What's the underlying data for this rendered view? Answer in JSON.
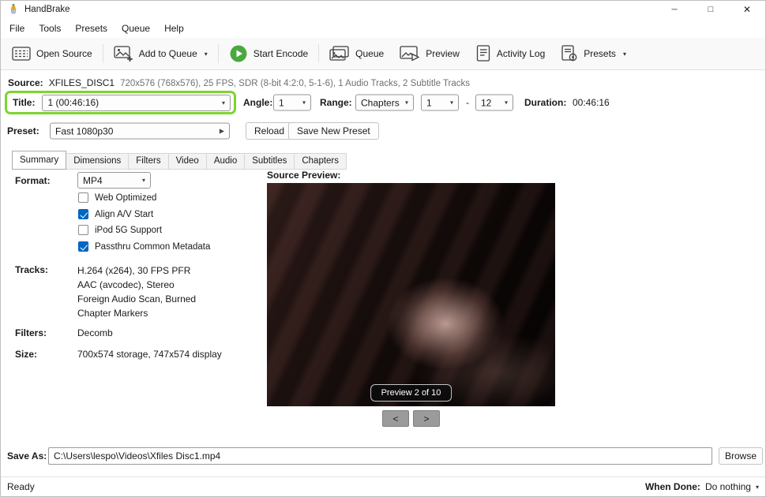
{
  "colors": {
    "highlight_green": "#7cd52e",
    "encode_green": "#4ba83f",
    "checkbox_blue": "#0067c0"
  },
  "icons": {
    "minimize": "─",
    "maximize": "□",
    "close": "✕",
    "chevron_down": "▾",
    "chevron_right": "▶",
    "prev": "<",
    "next": ">"
  },
  "window": {
    "title": "HandBrake"
  },
  "menu": {
    "items": [
      "File",
      "Tools",
      "Presets",
      "Queue",
      "Help"
    ]
  },
  "toolbar": {
    "open_source": "Open Source",
    "add_to_queue": "Add to Queue",
    "start_encode": "Start Encode",
    "queue": "Queue",
    "preview": "Preview",
    "activity_log": "Activity Log",
    "presets": "Presets"
  },
  "source": {
    "label": "Source:",
    "name": "XFILES_DISC1",
    "details": "720x576 (768x576), 25 FPS, SDR (8-bit 4:2:0, 5-1-6), 1 Audio Tracks, 2 Subtitle Tracks"
  },
  "title_row": {
    "title_label": "Title:",
    "title_value": "1 (00:46:16)",
    "angle_label": "Angle:",
    "angle_value": "1",
    "range_label": "Range:",
    "range_type": "Chapters",
    "range_start": "1",
    "range_separator": "-",
    "range_end": "12",
    "duration_label": "Duration:",
    "duration_value": "00:46:16"
  },
  "preset_row": {
    "label": "Preset:",
    "value": "Fast 1080p30",
    "reload": "Reload",
    "save_new_preset": "Save New Preset"
  },
  "tabs": {
    "items": [
      "Summary",
      "Dimensions",
      "Filters",
      "Video",
      "Audio",
      "Subtitles",
      "Chapters"
    ],
    "active": "Summary"
  },
  "summary": {
    "format_label": "Format:",
    "format_value": "MP4",
    "checkboxes": [
      {
        "label": "Web Optimized",
        "checked": false
      },
      {
        "label": "Align A/V Start",
        "checked": true
      },
      {
        "label": "iPod 5G Support",
        "checked": false
      },
      {
        "label": "Passthru Common Metadata",
        "checked": true
      }
    ],
    "tracks_label": "Tracks:",
    "tracks": [
      "H.264 (x264), 30 FPS PFR",
      "AAC (avcodec), Stereo",
      "Foreign Audio Scan, Burned",
      "Chapter Markers"
    ],
    "filters_label": "Filters:",
    "filters_value": "Decomb",
    "size_label": "Size:",
    "size_value": "700x574 storage, 747x574 display"
  },
  "preview": {
    "label": "Source Preview:",
    "badge": "Preview 2 of 10"
  },
  "save_as": {
    "label": "Save As:",
    "value": "C:\\Users\\lespo\\Videos\\Xfiles Disc1.mp4",
    "browse": "Browse"
  },
  "status": {
    "ready": "Ready",
    "when_done_label": "When Done:",
    "when_done_value": "Do nothing"
  }
}
